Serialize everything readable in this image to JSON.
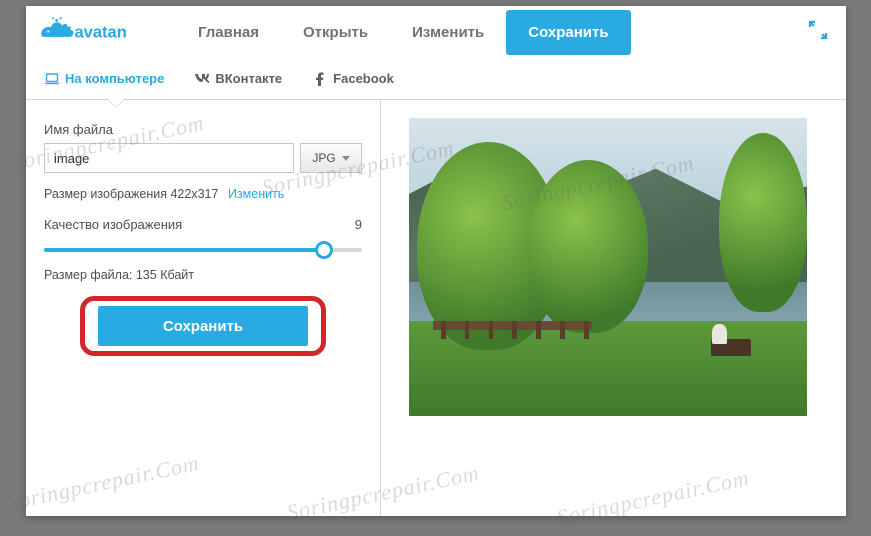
{
  "brand": "avatan",
  "nav": {
    "home": "Главная",
    "open": "Открыть",
    "edit": "Изменить",
    "save": "Сохранить"
  },
  "subtabs": {
    "computer": "На компьютере",
    "vk": "ВКонтакте",
    "facebook": "Facebook"
  },
  "panel": {
    "filename_label": "Имя файла",
    "filename_value": "image",
    "format": "JPG",
    "dimensions_label": "Размер изображения",
    "dimensions_value": "422x317",
    "change_link": "Изменить",
    "quality_label": "Качество изображения",
    "quality_value": "9",
    "filesize_label": "Размер файла:",
    "filesize_value": "135 Кбайт",
    "save_button": "Сохранить"
  },
  "watermark": "Soringpcrepair.Com"
}
